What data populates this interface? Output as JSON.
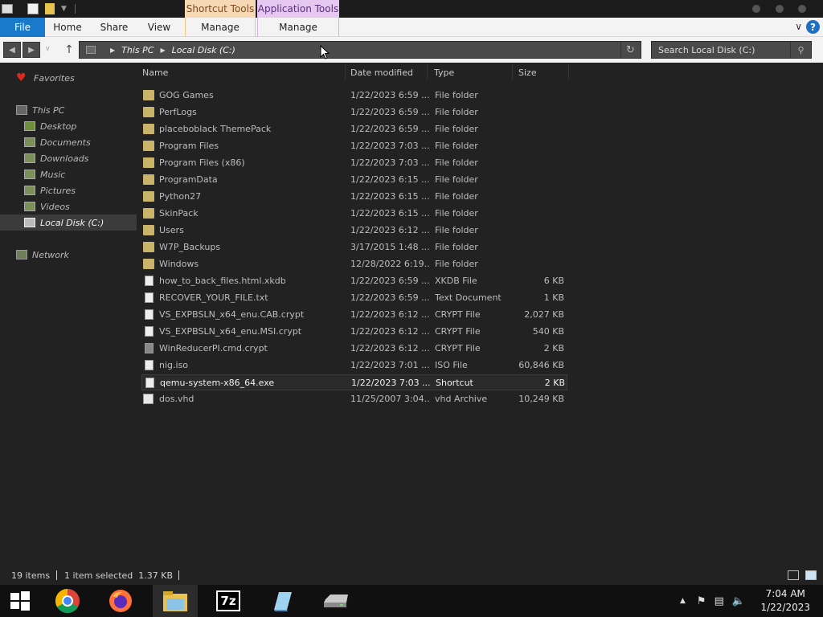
{
  "ribbon": {
    "context_tabs": {
      "shortcut_tools": "Shortcut Tools",
      "application_tools": "Application Tools"
    },
    "tabs": {
      "file": "File",
      "home": "Home",
      "share": "Share",
      "view": "View",
      "manage_shortcut": "Manage",
      "manage_app": "Manage"
    }
  },
  "address": {
    "root": "This PC",
    "current": "Local Disk (C:)"
  },
  "search": {
    "placeholder": "Search Local Disk (C:)"
  },
  "nav": {
    "favorites": "Favorites",
    "this_pc": "This PC",
    "desktop": "Desktop",
    "documents": "Documents",
    "downloads": "Downloads",
    "music": "Music",
    "pictures": "Pictures",
    "videos": "Videos",
    "local_disk": "Local Disk (C:)",
    "network": "Network"
  },
  "columns": {
    "name": "Name",
    "date": "Date modified",
    "type": "Type",
    "size": "Size"
  },
  "files": [
    {
      "name": "GOG Games",
      "date": "1/22/2023 6:59 ...",
      "type": "File folder",
      "size": "",
      "icon": "folder"
    },
    {
      "name": "PerfLogs",
      "date": "1/22/2023 6:59 ...",
      "type": "File folder",
      "size": "",
      "icon": "folder"
    },
    {
      "name": "placeboblack ThemePack",
      "date": "1/22/2023 6:59 ...",
      "type": "File folder",
      "size": "",
      "icon": "folder"
    },
    {
      "name": "Program Files",
      "date": "1/22/2023 7:03 ...",
      "type": "File folder",
      "size": "",
      "icon": "folder"
    },
    {
      "name": "Program Files (x86)",
      "date": "1/22/2023 7:03 ...",
      "type": "File folder",
      "size": "",
      "icon": "folder"
    },
    {
      "name": "ProgramData",
      "date": "1/22/2023 6:15 ...",
      "type": "File folder",
      "size": "",
      "icon": "folder"
    },
    {
      "name": "Python27",
      "date": "1/22/2023 6:15 ...",
      "type": "File folder",
      "size": "",
      "icon": "folder"
    },
    {
      "name": "SkinPack",
      "date": "1/22/2023 6:15 ...",
      "type": "File folder",
      "size": "",
      "icon": "folder"
    },
    {
      "name": "Users",
      "date": "1/22/2023 6:12 ...",
      "type": "File folder",
      "size": "",
      "icon": "folder"
    },
    {
      "name": "W7P_Backups",
      "date": "3/17/2015 1:48 ...",
      "type": "File folder",
      "size": "",
      "icon": "folder"
    },
    {
      "name": "Windows",
      "date": "12/28/2022 6:19...",
      "type": "File folder",
      "size": "",
      "icon": "folder"
    },
    {
      "name": "how_to_back_files.html.xkdb",
      "date": "1/22/2023 6:59 ...",
      "type": "XKDB File",
      "size": "6 KB",
      "icon": "doc"
    },
    {
      "name": "RECOVER_YOUR_FILE.txt",
      "date": "1/22/2023 6:59 ...",
      "type": "Text Document",
      "size": "1 KB",
      "icon": "doc"
    },
    {
      "name": "VS_EXPBSLN_x64_enu.CAB.crypt",
      "date": "1/22/2023 6:12 ...",
      "type": "CRYPT File",
      "size": "2,027 KB",
      "icon": "doc"
    },
    {
      "name": "VS_EXPBSLN_x64_enu.MSI.crypt",
      "date": "1/22/2023 6:12 ...",
      "type": "CRYPT File",
      "size": "540 KB",
      "icon": "doc"
    },
    {
      "name": "WinReducerPI.cmd.crypt",
      "date": "1/22/2023 6:12 ...",
      "type": "CRYPT File",
      "size": "2 KB",
      "icon": "doc-dark"
    },
    {
      "name": "nig.iso",
      "date": "1/22/2023 7:01 ...",
      "type": "ISO File",
      "size": "60,846 KB",
      "icon": "iso"
    },
    {
      "name": "qemu-system-x86_64.exe",
      "date": "1/22/2023 7:03 ...",
      "type": "Shortcut",
      "size": "2 KB",
      "icon": "doc"
    },
    {
      "name": "dos.vhd",
      "date": "11/25/2007 3:04...",
      "type": "vhd Archive",
      "size": "10,249 KB",
      "icon": "vhd"
    }
  ],
  "selected_index": 17,
  "status": {
    "count": "19 items",
    "selection": "1 item selected  1.37 KB"
  },
  "taskbar": {
    "apps": [
      "start-icon",
      "chrome-icon",
      "firefox-icon",
      "file-explorer-icon",
      "7zip-icon",
      "notepad-icon",
      "drive-icon"
    ],
    "label_7z": "7z",
    "time": "7:04 AM",
    "date": "1/22/2023"
  },
  "colors": {
    "file_tab": "#1979ca",
    "shortcut_tools": "#f6d9b4",
    "application_tools": "#e5c7f0",
    "folder": "#c9b46a",
    "favorites_heart": "#d9281d"
  }
}
